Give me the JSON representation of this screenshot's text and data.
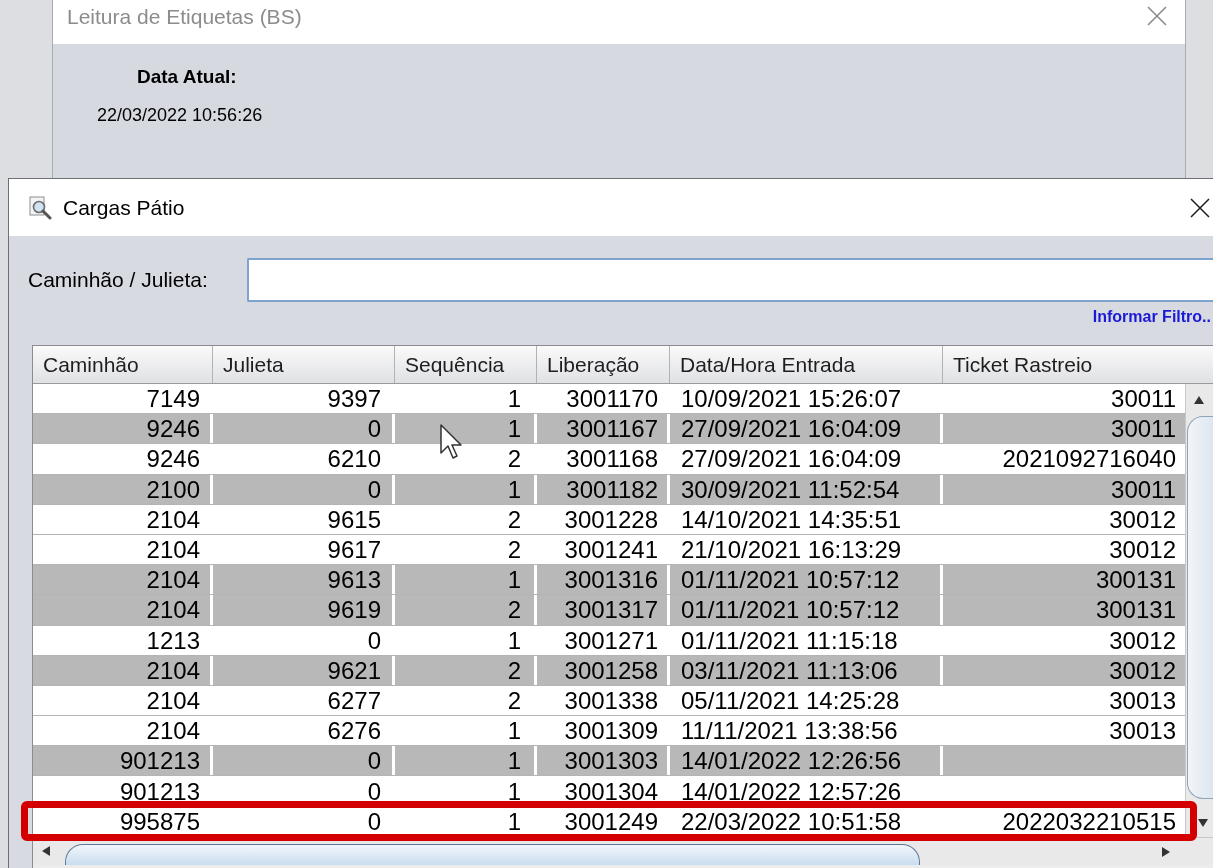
{
  "background_window": {
    "title": "Leitura de Etiquetas (BS)",
    "date_label": "Data Atual:",
    "date_value": "22/03/2022 10:56:26"
  },
  "dialog": {
    "title": "Cargas Pátio",
    "filter": {
      "label": "Caminhão / Julieta:"
    },
    "filter_link": "Informar Filtro.."
  },
  "table": {
    "columns": [
      "Caminhão",
      "Julieta",
      "Sequência",
      "Liberação",
      "Data/Hora Entrada",
      "Ticket Rastreio"
    ],
    "rows": [
      {
        "caminhao": "7149",
        "julieta": "9397",
        "sequencia": "1",
        "liberacao": "3001170",
        "data_hora_entrada": "10/09/2021 15:26:07",
        "ticket_rastreio": "30011",
        "shaded": false,
        "marked": false
      },
      {
        "caminhao": "9246",
        "julieta": "0",
        "sequencia": "1",
        "liberacao": "3001167",
        "data_hora_entrada": "27/09/2021 16:04:09",
        "ticket_rastreio": "30011",
        "shaded": true,
        "marked": false
      },
      {
        "caminhao": "9246",
        "julieta": "6210",
        "sequencia": "2",
        "liberacao": "3001168",
        "data_hora_entrada": "27/09/2021 16:04:09",
        "ticket_rastreio": "2021092716040",
        "shaded": false,
        "marked": false
      },
      {
        "caminhao": "2100",
        "julieta": "0",
        "sequencia": "1",
        "liberacao": "3001182",
        "data_hora_entrada": "30/09/2021 11:52:54",
        "ticket_rastreio": "30011",
        "shaded": true,
        "marked": false
      },
      {
        "caminhao": "2104",
        "julieta": "9615",
        "sequencia": "2",
        "liberacao": "3001228",
        "data_hora_entrada": "14/10/2021 14:35:51",
        "ticket_rastreio": "30012",
        "shaded": false,
        "marked": false
      },
      {
        "caminhao": "2104",
        "julieta": "9617",
        "sequencia": "2",
        "liberacao": "3001241",
        "data_hora_entrada": "21/10/2021 16:13:29",
        "ticket_rastreio": "30012",
        "shaded": false,
        "marked": false
      },
      {
        "caminhao": "2104",
        "julieta": "9613",
        "sequencia": "1",
        "liberacao": "3001316",
        "data_hora_entrada": "01/11/2021 10:57:12",
        "ticket_rastreio": "300131",
        "shaded": true,
        "marked": false
      },
      {
        "caminhao": "2104",
        "julieta": "9619",
        "sequencia": "2",
        "liberacao": "3001317",
        "data_hora_entrada": "01/11/2021 10:57:12",
        "ticket_rastreio": "300131",
        "shaded": true,
        "marked": false
      },
      {
        "caminhao": "1213",
        "julieta": "0",
        "sequencia": "1",
        "liberacao": "3001271",
        "data_hora_entrada": "01/11/2021 11:15:18",
        "ticket_rastreio": "30012",
        "shaded": false,
        "marked": false
      },
      {
        "caminhao": "2104",
        "julieta": "9621",
        "sequencia": "2",
        "liberacao": "3001258",
        "data_hora_entrada": "03/11/2021 11:13:06",
        "ticket_rastreio": "30012",
        "shaded": true,
        "marked": false
      },
      {
        "caminhao": "2104",
        "julieta": "6277",
        "sequencia": "2",
        "liberacao": "3001338",
        "data_hora_entrada": "05/11/2021 14:25:28",
        "ticket_rastreio": "30013",
        "shaded": false,
        "marked": false
      },
      {
        "caminhao": "2104",
        "julieta": "6276",
        "sequencia": "1",
        "liberacao": "3001309",
        "data_hora_entrada": "11/11/2021 13:38:56",
        "ticket_rastreio": "30013",
        "shaded": false,
        "marked": false
      },
      {
        "caminhao": "901213",
        "julieta": "0",
        "sequencia": "1",
        "liberacao": "3001303",
        "data_hora_entrada": "14/01/2022 12:26:56",
        "shaded": true,
        "marked": false
      },
      {
        "caminhao": "901213",
        "julieta": "0",
        "sequencia": "1",
        "liberacao": "3001304",
        "data_hora_entrada": "14/01/2022 12:57:26",
        "shaded": false,
        "marked": false
      },
      {
        "caminhao": "995875",
        "julieta": "0",
        "sequencia": "1",
        "liberacao": "3001249",
        "data_hora_entrada": "22/03/2022 10:51:58",
        "ticket_rastreio": "2022032210515",
        "shaded": false,
        "marked": true
      }
    ]
  }
}
